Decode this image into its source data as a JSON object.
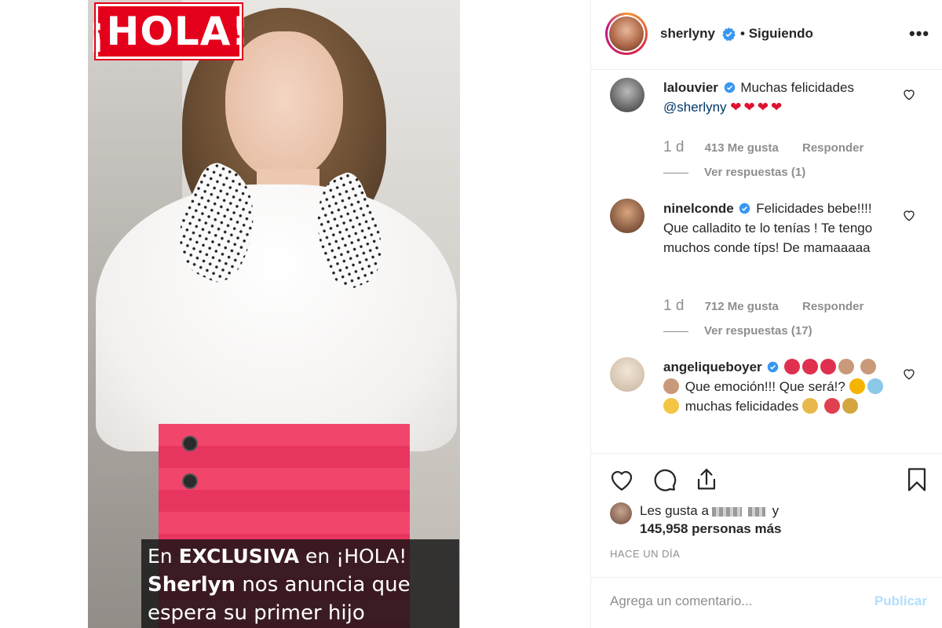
{
  "post": {
    "cover_logo": "¡HOLA!",
    "caption": {
      "line1_pre": "En ",
      "line1_bold": "EXCLUSIVA",
      "line1_post": " en ¡HOLA!",
      "line2_bold": "Sherlyn",
      "line2_post": " nos anuncia que",
      "line3": "espera su primer hijo"
    }
  },
  "header": {
    "username": "sherlyny",
    "separator": "•",
    "follow_status": "Siguiendo",
    "more_icon": "more-options-icon"
  },
  "comments": [
    {
      "user": "lalouvier",
      "text": "Muchas felicidades",
      "mention": "@sherlyny",
      "hearts": "❤❤❤❤",
      "time": "1 d",
      "likes": "413 Me gusta",
      "reply": "Responder",
      "view_replies": "Ver respuestas (1)"
    },
    {
      "user": "ninelconde",
      "text": "Felicidades bebe!!!! Que calladito te lo tenías ! Te tengo muchos conde típs! De mamaaaaa",
      "time": "1 d",
      "likes": "712 Me gusta",
      "reply": "Responder",
      "view_replies": "Ver respuestas (17)"
    },
    {
      "user": "angeliqueboyer",
      "text_a": "Que emoción!!! Que será!?",
      "text_b": "muchas felicidades"
    }
  ],
  "actions": {
    "like_icon": "heart-icon",
    "comment_icon": "comment-icon",
    "share_icon": "share-icon",
    "save_icon": "bookmark-icon"
  },
  "likes": {
    "prefix": "Les gusta a",
    "suffix": "y",
    "count_text": "145,958 personas más"
  },
  "timestamp": "HACE UN DÍA",
  "composer": {
    "placeholder": "Agrega un comentario...",
    "post_label": "Publicar"
  },
  "colors": {
    "hola_red": "#e4001b",
    "verified_blue": "#3897f0",
    "link_blue": "#00376b",
    "disabled_blue": "#b2dffc"
  }
}
